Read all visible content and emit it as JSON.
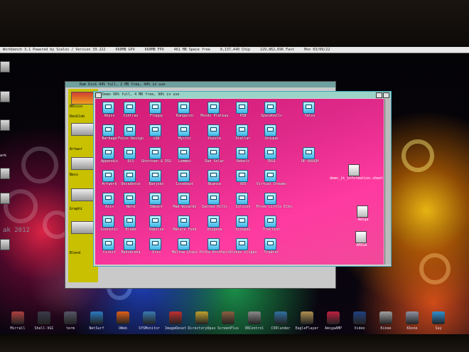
{
  "screenbar": {
    "items": [
      "Workbench 3.1 Powered by Scalos / Version 39.222",
      "660MB GPU",
      "660MB FPU",
      "461 MB Space free",
      "8,137,440 Chip",
      "229,862,696 Fast",
      "Mon 03/09/22"
    ]
  },
  "desktop": {
    "year_label": "ak 2012",
    "left_labels": [
      "ark"
    ]
  },
  "back_window": {
    "title": "Ram Disk  44% full, 2 MB free, 40% in use",
    "items": [
      "RDisco",
      "DexGlob",
      "Artwor",
      "Bess",
      "Graphi",
      "Blend"
    ]
  },
  "front_window": {
    "title": "Demo  98% full, 4 MB free, 98% in use",
    "drawers": [
      [
        "Abyss",
        "Contraz",
        "Floppy",
        "Kangaroo",
        "Moods Plateau",
        "PSB",
        "Spaceballs",
        "Talos"
      ],
      [
        "Barbage",
        "Focus Design",
        "LSD",
        "Mystic",
        "Puzzle",
        "Stellar",
        "Unique"
      ],
      [
        "Appendix",
        "DCS",
        "Ghostown & DSS",
        "Lemmes",
        "Dah Solar",
        "Rebels",
        "TRSI",
        "UP ROUGH"
      ],
      [
        "Artwork",
        "Decadence",
        "Banjobs",
        "Lovebeat",
        "Nuance",
        "VDS",
        "Virtual Dreams"
      ],
      [
        "Axis",
        "Nerd",
        "Impact",
        "Mad Wizards",
        "Sacred Hills",
        "Silicon",
        "Three Little Elks"
      ],
      [
        "Loonatic",
        "Elude",
        "Impulse",
        "Mature Funk",
        "Oxygene",
        "Scoopex",
        "Traction"
      ],
      [
        "Cirkit",
        "Ephidrena",
        "Iris",
        "Mellow Chips",
        "Polka Brothers",
        "Stonks Clipps",
        "Traktor"
      ]
    ],
    "files": [
      "demo_jk_information.sheet",
      "Amiga",
      "AMIGA"
    ]
  },
  "dock": {
    "items": [
      {
        "label": "Mirrall",
        "color": "#b04040"
      },
      {
        "label": "Shell-VGC",
        "color": "#3a3a4a"
      },
      {
        "label": "term",
        "color": "#556"
      },
      {
        "label": "NetSurf",
        "color": "#2a7ac0"
      },
      {
        "label": "OWeb",
        "color": "#e0601a"
      },
      {
        "label": "SYSMonitor",
        "color": "#3a7ab0"
      },
      {
        "label": "ImageDeset",
        "color": "#c03030"
      },
      {
        "label": "DirectoryOpus",
        "color": "#c0a030"
      },
      {
        "label": "ScreenPlus",
        "color": "#8a6040"
      },
      {
        "label": "VRControl",
        "color": "#8a8a8a"
      },
      {
        "label": "CVDlunder",
        "color": "#3070a0"
      },
      {
        "label": "EagleFlayer",
        "color": "#b09050"
      },
      {
        "label": "AmigaAMP",
        "color": "#c02040"
      },
      {
        "label": "Video",
        "color": "#204080"
      },
      {
        "label": "Kinee",
        "color": "#a0a0a0"
      },
      {
        "label": "Kkone",
        "color": "#9090a0"
      },
      {
        "label": "Say",
        "color": "#3090d0"
      }
    ]
  }
}
